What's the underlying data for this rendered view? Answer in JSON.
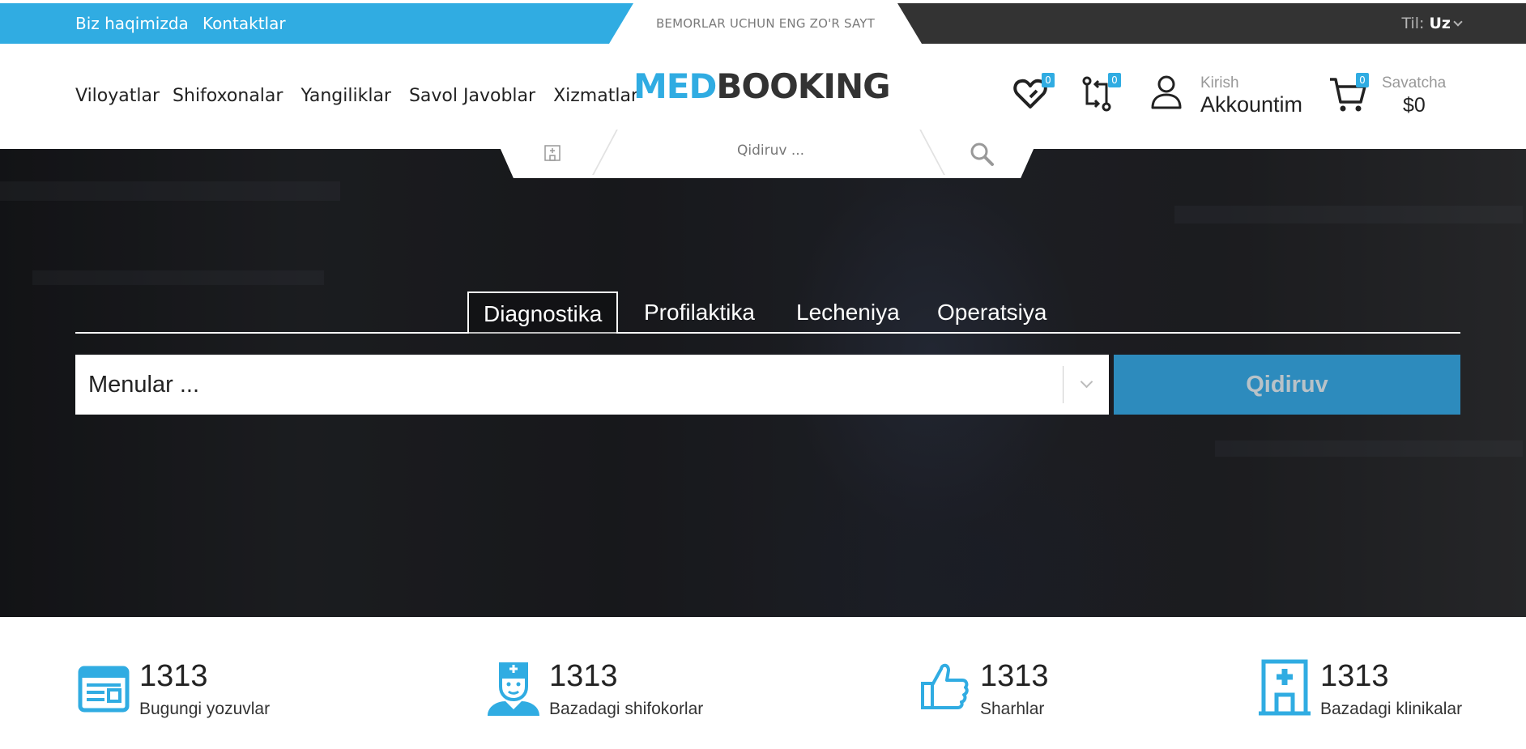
{
  "topbar": {
    "links": [
      "Biz haqimizda",
      "Kontaktlar"
    ],
    "tagline": "BEMORLAR UCHUN ENG ZO'R SAYT",
    "language_label": "Til:",
    "language_value": "Uz"
  },
  "header": {
    "nav": [
      "Viloyatlar",
      "Shifoxonalar",
      "Yangiliklar",
      "Savol Javoblar",
      "Xizmatlar"
    ],
    "logo_part1": "MED",
    "logo_part2": "BOOKING",
    "wishlist_count": "0",
    "compare_count": "0",
    "account_small": "Kirish",
    "account_big": "Akkountim",
    "cart_count": "0",
    "cart_small": "Savatcha",
    "cart_big": "$0",
    "search_placeholder": "Qidiruv ..."
  },
  "hero": {
    "tabs": [
      "Diagnostika",
      "Profilaktika",
      "Lecheniya",
      "Operatsiya"
    ],
    "active_tab": "Diagnostika",
    "select_placeholder": "Menular ...",
    "search_button": "Qidiruv"
  },
  "stats": [
    {
      "icon": "newspaper-icon",
      "number": "1313",
      "label": "Bugungi yozuvlar"
    },
    {
      "icon": "doctor-icon",
      "number": "1313",
      "label": "Bazadagi shifokorlar"
    },
    {
      "icon": "thumbs-up-icon",
      "number": "1313",
      "label": "Sharhlar"
    },
    {
      "icon": "hospital-icon",
      "number": "1313",
      "label": "Bazadagi klinikalar"
    }
  ],
  "colors": {
    "accent": "#30ace2",
    "dark": "#333333",
    "search_button": "#2d8bbd"
  }
}
